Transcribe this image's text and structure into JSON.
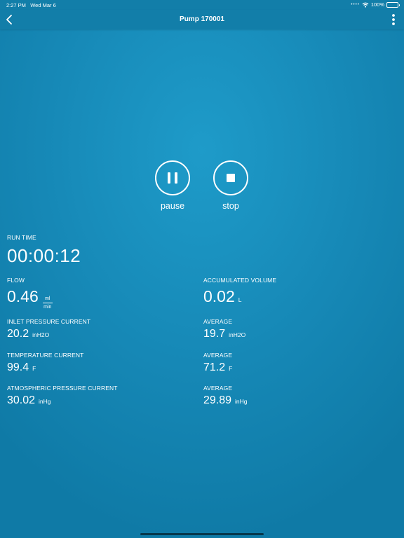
{
  "status": {
    "time": "2:27 PM",
    "date": "Wed Mar 6",
    "battery": "100%",
    "battery_level": 1.0
  },
  "nav": {
    "title": "Pump 170001"
  },
  "controls": {
    "pause_label": "pause",
    "stop_label": "stop"
  },
  "run_time": {
    "label": "RUN TIME",
    "value": "00:00:12"
  },
  "flow": {
    "label": "FLOW",
    "value": "0.46",
    "unit_top": "ml",
    "unit_bottom": "min"
  },
  "accumulated_volume": {
    "label": "ACCUMULATED VOLUME",
    "value": "0.02",
    "unit": "L"
  },
  "inlet_pressure": {
    "label": "INLET PRESSURE CURRENT",
    "value": "20.2",
    "unit": "inH2O"
  },
  "inlet_pressure_avg": {
    "label": "AVERAGE",
    "value": "19.7",
    "unit": "inH2O"
  },
  "temperature": {
    "label": "TEMPERATURE CURRENT",
    "value": "99.4",
    "unit": "F"
  },
  "temperature_avg": {
    "label": "AVERAGE",
    "value": "71.2",
    "unit": "F"
  },
  "atm_pressure": {
    "label": "ATMOSPHERIC PRESSURE CURRENT",
    "value": "30.02",
    "unit": "inHg"
  },
  "atm_pressure_avg": {
    "label": "AVERAGE",
    "value": "29.89",
    "unit": "inHg"
  },
  "colors": {
    "background": "#1688b6",
    "bar": "#127ea9",
    "foreground": "#ffffff"
  }
}
